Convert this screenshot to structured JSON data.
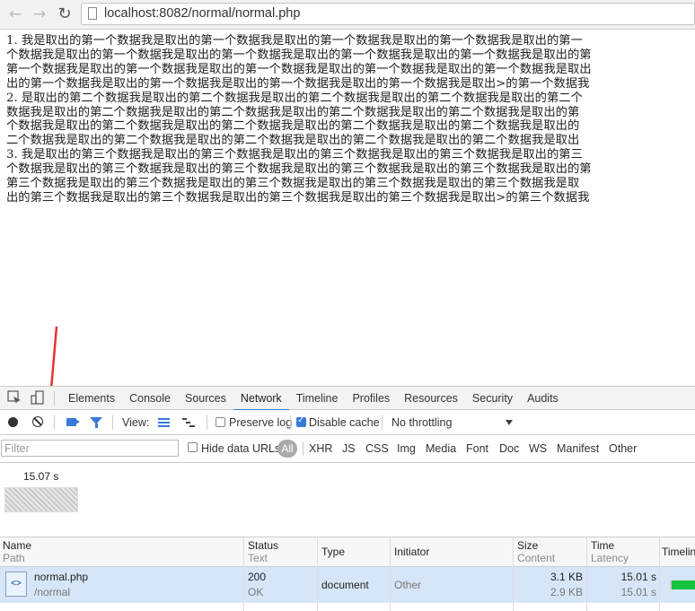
{
  "browser": {
    "back_icon": "arrow-left-icon",
    "forward_icon": "arrow-right-icon",
    "reload_icon": "reload-icon",
    "url": "localhost:8082/normal/normal.php"
  },
  "page": {
    "paragraphs": [
      {
        "lines": [
          "1. 我是取出的第一个数据我是取出的第一个数据我是取出的第一个数据我是取出的第一个数据我是取出的第一",
          "个数据我是取出的第一个数据我是取出的第一个数据我是取出的第一个数据我是取出的第一个数据我是取出的第",
          "第一个数据我是取出的第一个数据我是取出的第一个数据我是取出的第一个数据我是取出的第一个数据我是取出",
          "出的第一个数据我是取出的第一个数据我是取出的第一个数据我是取出的第一个数据我是取出>的第一个数据我"
        ]
      },
      {
        "lines": [
          "2. 是取出的第二个数据我是取出的第二个数据我是取出的第二个数据我是取出的第二个数据我是取出的第二个",
          "数据我是取出的第二个数据我是取出的第二个数据我是取出的第二个数据我是取出的第二个数据我是取出的第",
          "个数据我是取出的第二个数据我是取出的第二个数据我是取出的第二个数据我是取出的第二个数据我是取出的",
          "二个数据我是取出的第二个数据我是取出的第二个数据我是取出的第二个数据我是取出的第二个数据我是取出"
        ]
      },
      {
        "lines": [
          "3. 我是取出的第三个数据我是取出的第三个数据我是取出的第三个数据我是取出的第三个数据我是取出的第三",
          "个数据我是取出的第三个数据我是取出的第三个数据我是取出的第三个数据我是取出的第三个数据我是取出的第",
          "第三个数据我是取出的第三个数据我是取出的第三个数据我是取出的第三个数据我是取出的第三个数据我是取",
          "出的第三个数据我是取出的第三个数据我是取出的第三个数据我是取出的第三个数据我是取出>的第三个数据我"
        ]
      }
    ]
  },
  "devtools": {
    "tabs": [
      "Elements",
      "Console",
      "Sources",
      "Network",
      "Timeline",
      "Profiles",
      "Resources",
      "Security",
      "Audits"
    ],
    "active_tab": "Network",
    "toolbar": {
      "view_label": "View:",
      "preserve_log": {
        "label": "Preserve log",
        "checked": false
      },
      "disable_cache": {
        "label": "Disable cache",
        "checked": true
      },
      "throttling": "No throttling"
    },
    "filter": {
      "placeholder": "Filter",
      "hide_data_urls": "Hide data URLs",
      "all": "All",
      "types": [
        "XHR",
        "JS",
        "CSS",
        "Img",
        "Media",
        "Font",
        "Doc",
        "WS",
        "Manifest",
        "Other"
      ]
    },
    "overview": {
      "time": "15.07 s"
    },
    "columns": {
      "name": {
        "top": "Name",
        "bottom": "Path"
      },
      "status": {
        "top": "Status",
        "bottom": "Text"
      },
      "type": {
        "top": "Type"
      },
      "initiator": {
        "top": "Initiator"
      },
      "size": {
        "top": "Size",
        "bottom": "Content"
      },
      "time": {
        "top": "Time",
        "bottom": "Latency"
      },
      "timeline": {
        "top": "Timeline"
      }
    },
    "requests": [
      {
        "name": "normal.php",
        "path": "/normal",
        "status": "200",
        "status_text": "OK",
        "type": "document",
        "initiator": "Other",
        "size": "3.1 KB",
        "content": "2.9 KB",
        "time": "15.01 s",
        "latency": "15.01 s"
      }
    ],
    "colors": {
      "accent": "#3879d9",
      "selected_row": "#d6e6f8",
      "timing_bar": "#14c43c",
      "annotation_arrow": "#e3342f"
    }
  }
}
